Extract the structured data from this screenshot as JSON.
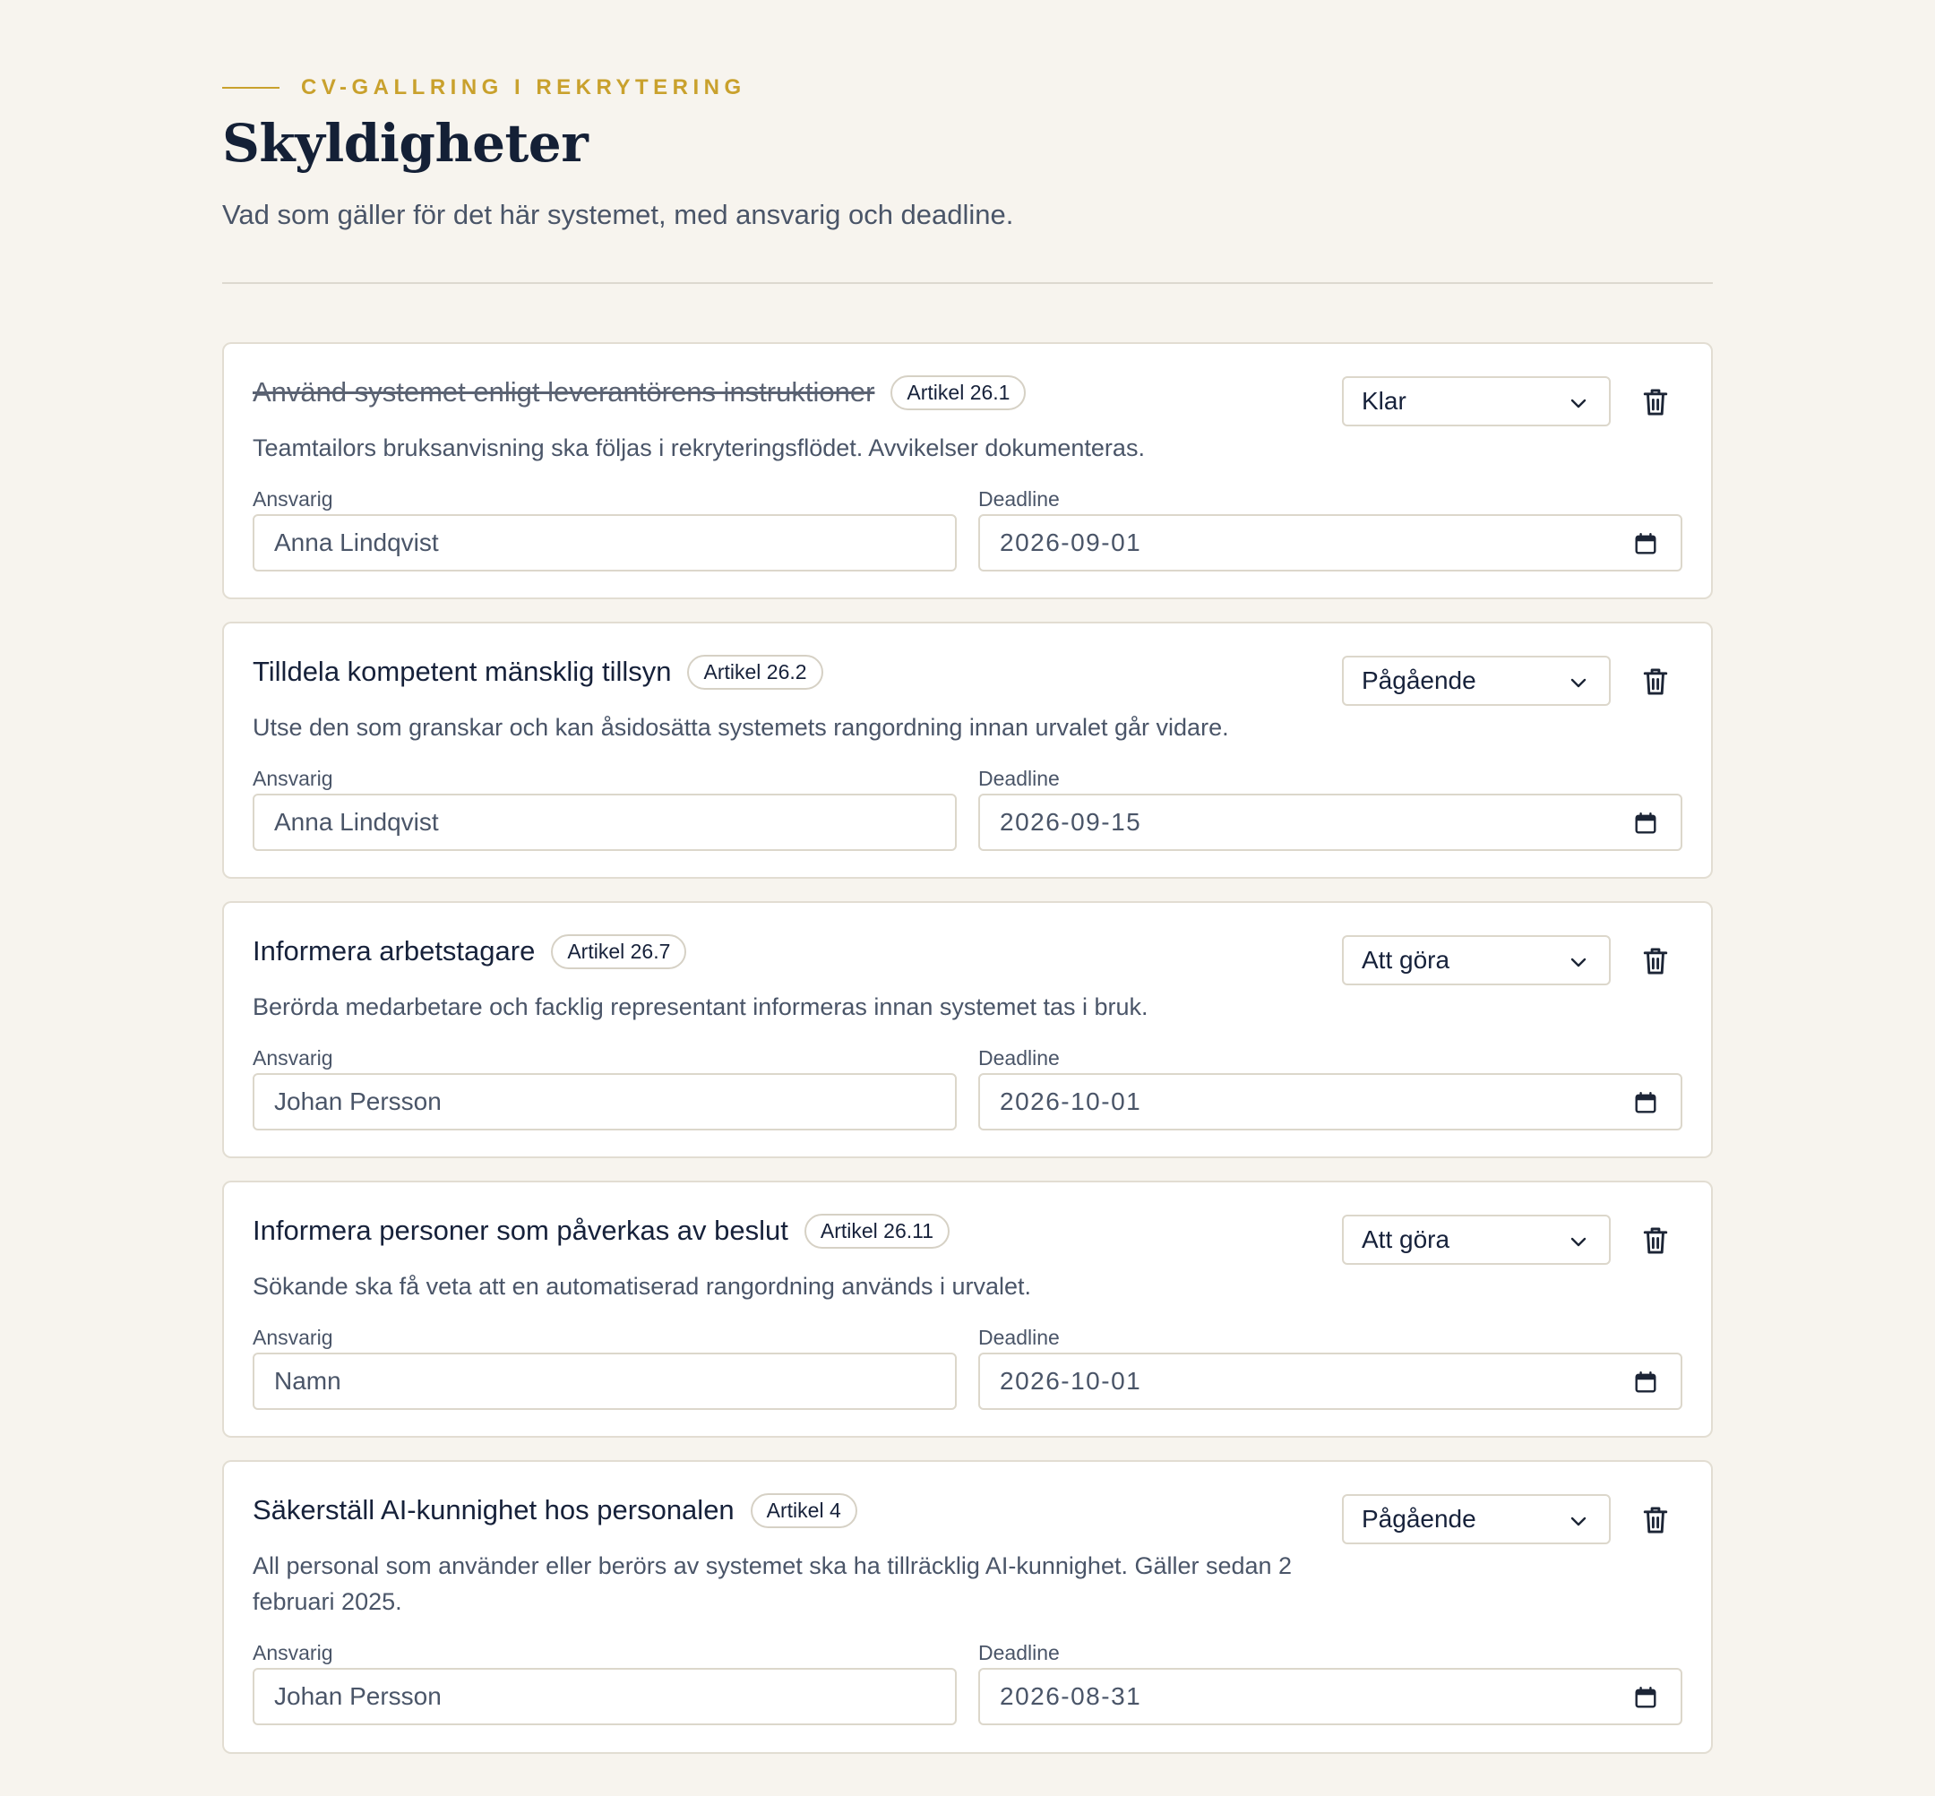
{
  "header": {
    "eyebrow": "CV-GALLRING I REKRYTERING",
    "title": "Skyldigheter",
    "subtitle": "Vad som gäller för det här systemet, med ansvarig och deadline."
  },
  "labels": {
    "owner": "Ansvarig",
    "deadline": "Deadline"
  },
  "colors": {
    "accent": "#c9a12d",
    "background": "#f7f4ee",
    "title": "#142036"
  },
  "icons": {
    "status_dropdown": "chevron-down-icon",
    "delete": "trash-icon",
    "date": "calendar-icon"
  },
  "obligations": [
    {
      "title": "Använd systemet enligt leverantörens instruktioner",
      "article": "Artikel 26.1",
      "description": "Teamtailors bruksanvisning ska följas i rekryteringsflödet. Avvikelser dokumenteras.",
      "status": "Klar",
      "owner": "Anna Lindqvist",
      "deadline": "2026-09-01",
      "completed": true
    },
    {
      "title": "Tilldela kompetent mänsklig tillsyn",
      "article": "Artikel 26.2",
      "description": "Utse den som granskar och kan åsidosätta systemets rangordning innan urvalet går vidare.",
      "status": "Pågående",
      "owner": "Anna Lindqvist",
      "deadline": "2026-09-15",
      "completed": false
    },
    {
      "title": "Informera arbetstagare",
      "article": "Artikel 26.7",
      "description": "Berörda medarbetare och facklig representant informeras innan systemet tas i bruk.",
      "status": "Att göra",
      "owner": "Johan Persson",
      "deadline": "2026-10-01",
      "completed": false
    },
    {
      "title": "Informera personer som påverkas av beslut",
      "article": "Artikel 26.11",
      "description": "Sökande ska få veta att en automatiserad rangordning används i urvalet.",
      "status": "Att göra",
      "owner": "",
      "owner_placeholder": "Namn",
      "deadline": "2026-10-01",
      "completed": false
    },
    {
      "title": "Säkerställ AI-kunnighet hos personalen",
      "article": "Artikel 4",
      "description": "All personal som använder eller berörs av systemet ska ha tillräcklig AI-kunnighet. Gäller sedan 2 februari 2025.",
      "status": "Pågående",
      "owner": "Johan Persson",
      "deadline": "2026-08-31",
      "completed": false
    }
  ]
}
